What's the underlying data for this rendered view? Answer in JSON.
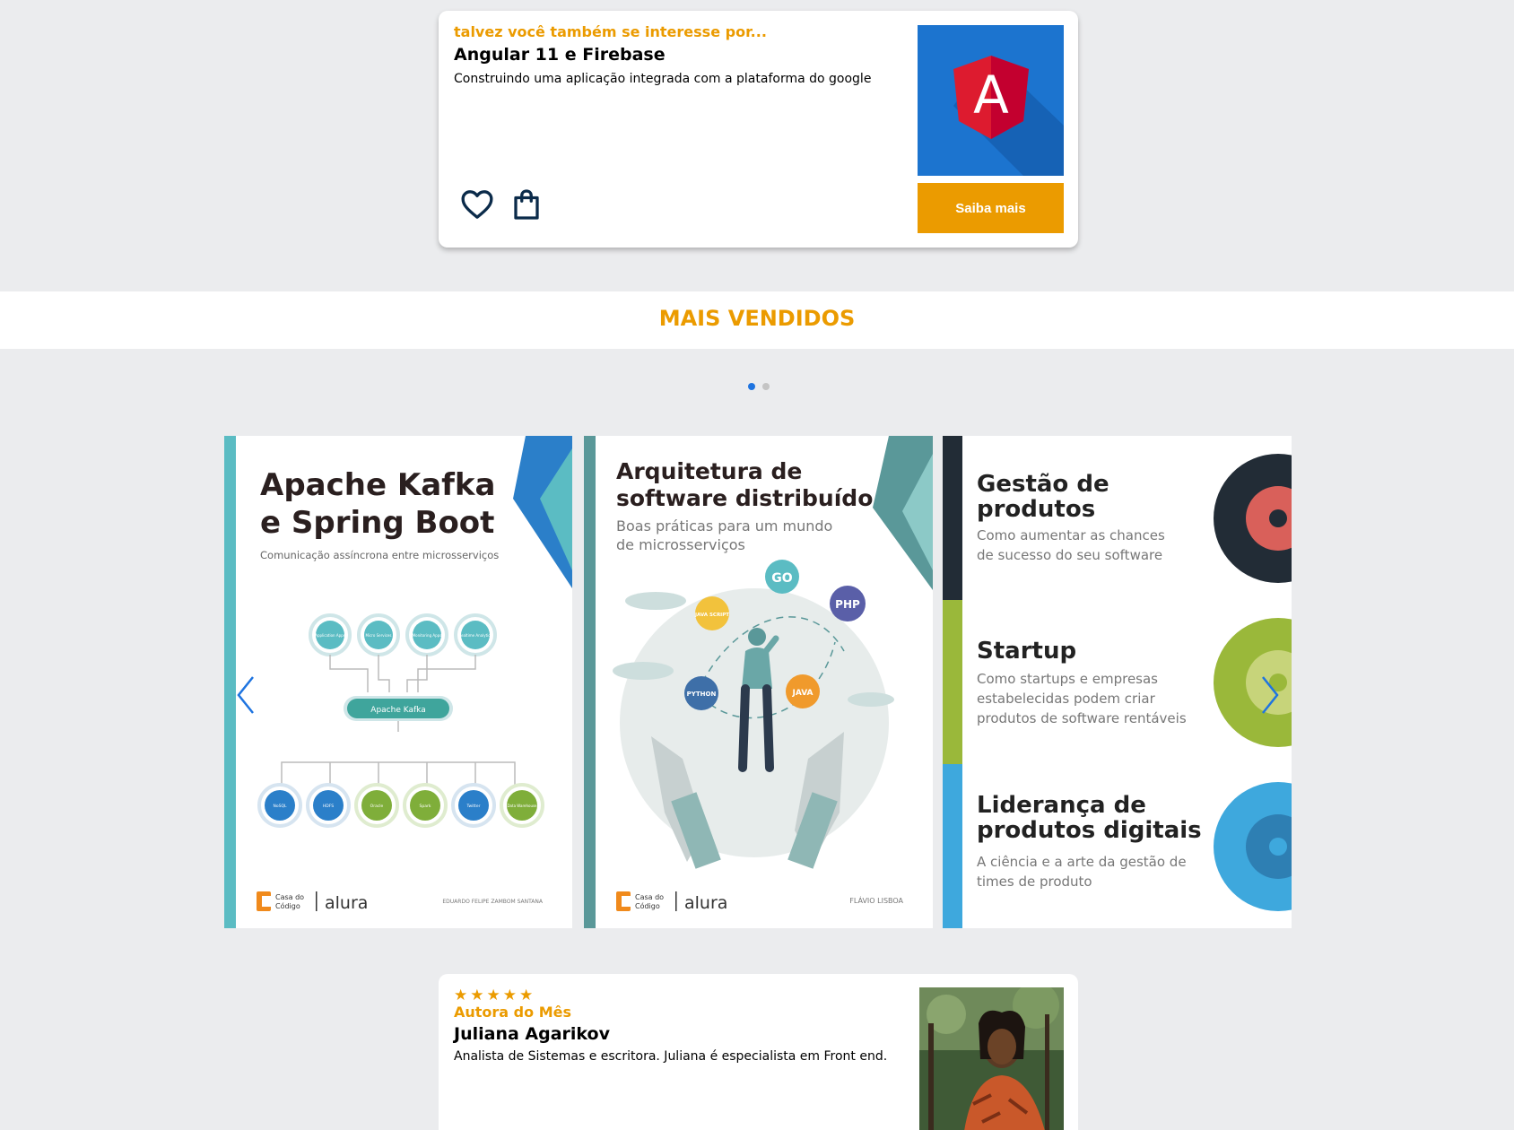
{
  "recommendation": {
    "eyebrow": "talvez você também se interesse por...",
    "title": "Angular 11 e Firebase",
    "description": "Construindo uma aplicação integrada com a plataforma do google",
    "cover_letter": "A",
    "cta_label": "Saiba mais",
    "icons": [
      "heart-icon",
      "shopping-bag-icon"
    ]
  },
  "section": {
    "title": "MAIS VENDIDOS"
  },
  "carousel": {
    "active_page": 1,
    "page_count": 2,
    "books": [
      {
        "title_line1": "Apache Kafka",
        "title_line2": "e Spring Boot",
        "subtitle": "Comunicação assíncrona entre microsserviços",
        "top_nodes": [
          "Application Apps",
          "Micro Services",
          "Monitoring Apps",
          "Realtime Analytics"
        ],
        "hub_label": "Apache Kafka",
        "bottom_nodes": [
          "NoSQL",
          "HDFS",
          "Oracle",
          "Spark",
          "Twitter",
          "Data Warehouse"
        ],
        "publisher_line1": "Casa do",
        "publisher_line2": "Código",
        "brand": "alura",
        "author": "EDUARDO FELIPE ZAMBOM SANTANA"
      },
      {
        "title_line1": "Arquitetura de",
        "title_line2": "software distribuído",
        "subtitle_line1": "Boas práticas para um mundo",
        "subtitle_line2": "de microsserviços",
        "tech_labels": [
          "GO",
          "PHP",
          "JAVA SCRIPT",
          "PYTHON",
          "JAVA"
        ],
        "publisher_line1": "Casa do",
        "publisher_line2": "Código",
        "brand": "alura",
        "author": "FLÁVIO LISBOA"
      },
      {
        "sections": [
          {
            "title_line1": "Gestão de",
            "title_line2": "produtos",
            "text_line1": "Como aumentar as chances",
            "text_line2": "de sucesso do seu software",
            "text_line3": ""
          },
          {
            "title_line1": "Startup",
            "title_line2": "",
            "text_line1": "Como startups e empresas",
            "text_line2": "estabelecidas  podem criar",
            "text_line3": "produtos de software rentáveis"
          },
          {
            "title_line1": "Liderança de",
            "title_line2": "produtos digitais",
            "text_line1": "A ciência e a arte da gestão de",
            "text_line2": "times de produto",
            "text_line3": ""
          }
        ]
      }
    ]
  },
  "author_of_month": {
    "stars": "★★★★★",
    "eyebrow": "Autora do Mês",
    "name": "Juliana Agarikov",
    "bio": "Analista de Sistemas e escritora. Juliana é especialista em Front end."
  },
  "colors": {
    "accent": "#eb9b00",
    "active_dot": "#1e74e0",
    "background": "#ebecee",
    "angular_blue": "#1c74cf",
    "angular_red": "#dd1b2f"
  }
}
